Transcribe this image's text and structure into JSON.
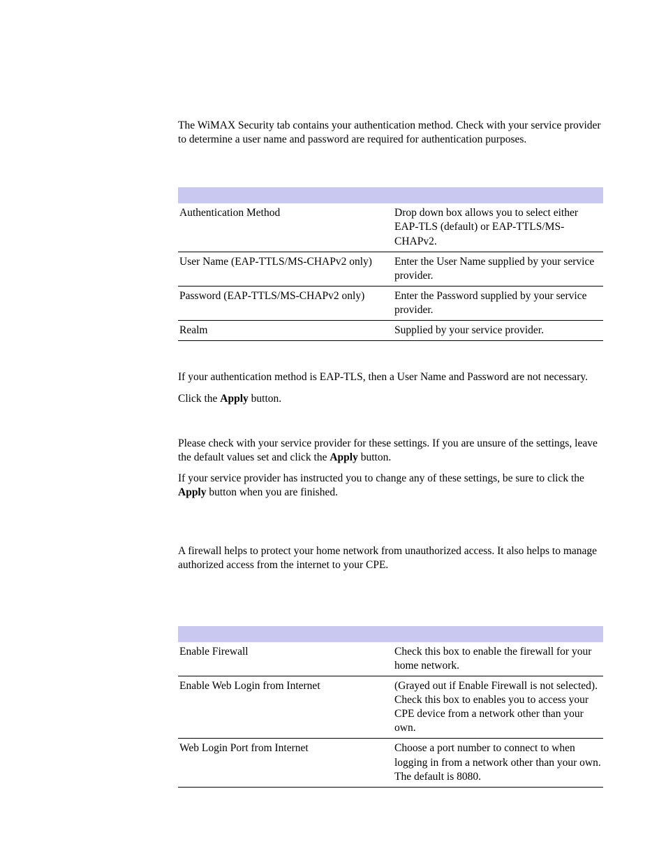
{
  "intro": "The WiMAX Security tab contains your authentication method. Check with your service provider to determine a user name and password are required for authentication purposes.",
  "table1": {
    "rows": [
      {
        "label": "Authentication Method",
        "desc": "Drop down box allows you to select either EAP-TLS (default) or EAP-TTLS/MS-CHAPv2."
      },
      {
        "label": "User Name (EAP-TTLS/MS-CHAPv2 only)",
        "desc": "Enter the User Name supplied by your service provider."
      },
      {
        "label": "Password (EAP-TTLS/MS-CHAPv2 only)",
        "desc": "Enter the Password supplied by your service provider."
      },
      {
        "label": "Realm",
        "desc": "Supplied by your service provider."
      }
    ]
  },
  "mid_paragraphs": {
    "p1": "If your authentication method is EAP-TLS, then a User Name and Password are not necessary.",
    "p2_prefix": "Click the ",
    "p2_bold": "Apply",
    "p2_suffix": " button.",
    "p3_prefix": "Please check with your service provider for these settings. If you are unsure of the settings, leave the default values set and click the ",
    "p3_bold": "Apply",
    "p3_suffix": " button.",
    "p4_prefix": "If your service provider has instructed you to change any of these settings, be sure to click the ",
    "p4_bold": "Apply",
    "p4_suffix": " button when you are finished."
  },
  "firewall_intro": "A firewall helps to protect your home network from unauthorized access. It also helps to manage authorized access from the internet to your CPE.",
  "table2": {
    "rows": [
      {
        "label": "Enable Firewall",
        "desc": "Check this box to enable the firewall for your home network."
      },
      {
        "label": "Enable Web Login from Internet",
        "desc": "(Grayed out if Enable Firewall is not selected).\nCheck this box to enables you to access your CPE device from a network other than your own."
      },
      {
        "label": "Web Login Port from Internet",
        "desc": "Choose a port number to connect to when logging in from a network other than your own. The default is 8080."
      }
    ]
  }
}
